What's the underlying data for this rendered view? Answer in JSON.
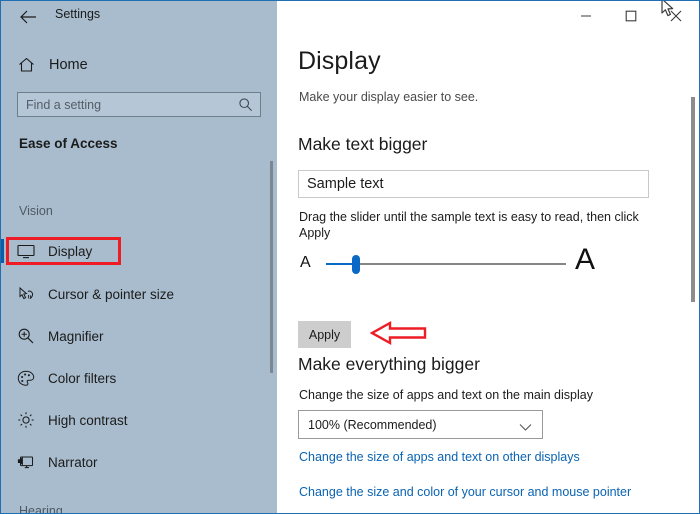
{
  "window": {
    "app_name": "Settings",
    "back_icon": "back-arrow-icon",
    "minimize_label": "–",
    "maximize_label": "☐",
    "close_label": "×"
  },
  "sidebar": {
    "home_label": "Home",
    "home_icon": "home-icon",
    "search": {
      "placeholder": "Find a setting",
      "value": "",
      "icon": "search-icon"
    },
    "category": "Ease of Access",
    "groups": [
      {
        "label": "Vision",
        "items": [
          {
            "label": "Display",
            "icon": "monitor-icon",
            "selected": true
          },
          {
            "label": "Cursor & pointer size",
            "icon": "cursor-pointer-icon",
            "selected": false
          },
          {
            "label": "Magnifier",
            "icon": "magnifier-icon",
            "selected": false
          },
          {
            "label": "Color filters",
            "icon": "color-palette-icon",
            "selected": false
          },
          {
            "label": "High contrast",
            "icon": "brightness-icon",
            "selected": false
          },
          {
            "label": "Narrator",
            "icon": "narrator-icon",
            "selected": false
          }
        ]
      }
    ],
    "next_group_partial": "Hearing"
  },
  "main": {
    "title": "Display",
    "subtitle": "Make your display easier to see.",
    "text_section": {
      "heading": "Make text bigger",
      "sample_text": "Sample text",
      "instruction": "Drag the slider until the sample text is easy to read, then click Apply",
      "slider": {
        "min_label": "A",
        "max_label": "A",
        "value_percent": 12
      },
      "apply_label": "Apply"
    },
    "scale_section": {
      "heading": "Make everything bigger",
      "description": "Change the size of apps and text on the main display",
      "dropdown_value": "100% (Recommended)",
      "dropdown_chevron": "chevron-down-icon"
    },
    "links": [
      "Change the size of apps and text on other displays",
      "Change the size and color of your cursor and mouse pointer"
    ]
  },
  "annotations": {
    "highlight_color": "#ee1c25",
    "arrow_target": "Apply",
    "highlight_target": "Display"
  }
}
